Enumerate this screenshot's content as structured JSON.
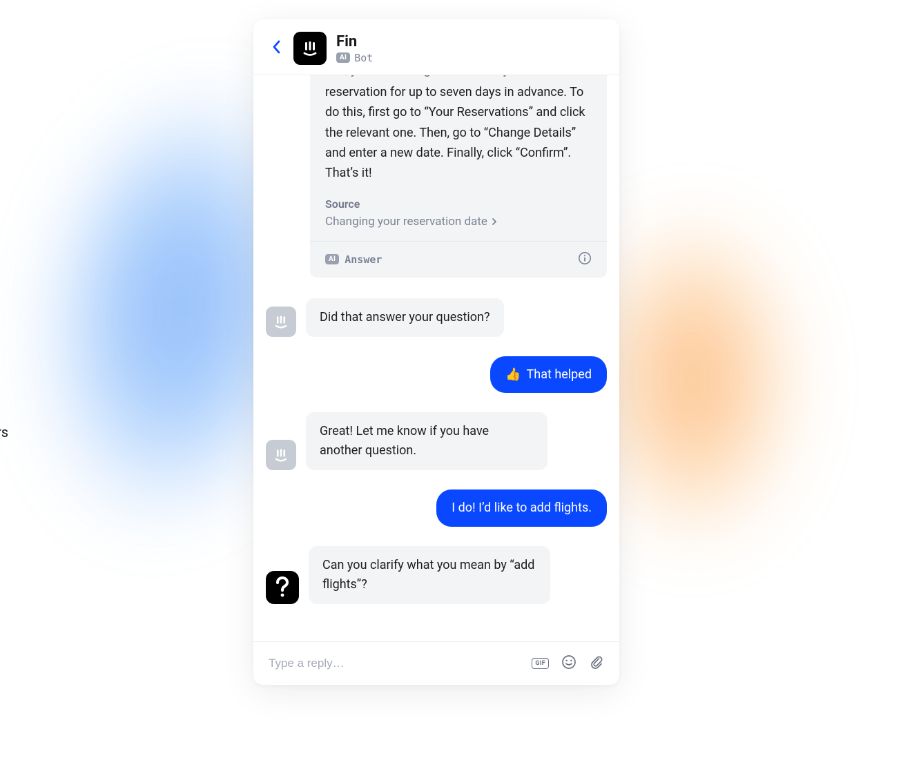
{
  "partial_bg_text": "rs",
  "header": {
    "name": "Fin",
    "ai_badge": "AI",
    "role": "Bot"
  },
  "answer_card": {
    "cutoff_text": "Yes, you can change the date of your",
    "body": "reservation for up to seven days in advance. To do this, first go to “Your Reservations” and click the relevant one. Then, go to “Change Details” and enter a new date. Finally, click “Confirm”. That’s it!",
    "source_label": "Source",
    "source_link": "Changing your reservation date",
    "footer_ai_badge": "AI",
    "footer_label": "Answer"
  },
  "messages": {
    "bot_followup_1": "Did that answer your question?",
    "user_reply_1_emoji": "👍",
    "user_reply_1_text": "That helped",
    "bot_followup_2": "Great! Let me know if you have another question.",
    "user_reply_2": "I do! I’d like to add flights.",
    "bot_clarify": "Can you clarify what you mean by “add flights”?"
  },
  "compose": {
    "placeholder": "Type a reply…",
    "gif_label": "GIF"
  }
}
